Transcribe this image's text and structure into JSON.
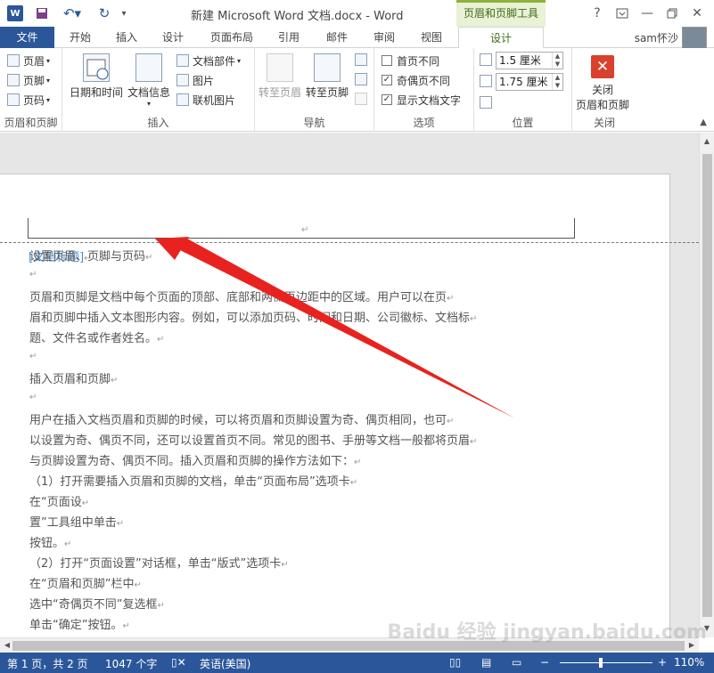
{
  "title_bar": {
    "doc_title": "新建 Microsoft Word 文档.docx - Word",
    "contextual_tab": "页眉和页脚工具",
    "help": "?"
  },
  "tabs": {
    "file": "文件",
    "items": [
      "开始",
      "插入",
      "设计",
      "页面布局",
      "引用",
      "邮件",
      "审阅",
      "视图"
    ],
    "active": "设计",
    "user": "sam怀沙"
  },
  "ribbon": {
    "group1": {
      "items": [
        "页眉",
        "页脚",
        "页码"
      ],
      "label": "页眉和页脚"
    },
    "group2": {
      "datetime": "日期和时间",
      "docinfo": "文档信息",
      "quickparts": "文档部件",
      "picture": "图片",
      "onlinepicture": "联机图片",
      "label": "插入"
    },
    "group3": {
      "goto_header": "转至页眉",
      "goto_footer": "转至页脚",
      "label": "导航"
    },
    "group4": {
      "options": [
        {
          "label": "首页不同",
          "checked": false
        },
        {
          "label": "奇偶页不同",
          "checked": true
        },
        {
          "label": "显示文档文字",
          "checked": true
        }
      ],
      "label": "选项"
    },
    "group5": {
      "header_pos": "1.5 厘米",
      "footer_pos": "1.75 厘米",
      "label": "位置"
    },
    "group6": {
      "close": "关闭",
      "close2": "页眉和页脚",
      "label": "关闭"
    }
  },
  "document": {
    "header_field": "[文档标题]",
    "lines": [
      "设置页眉、页脚与页码",
      "",
      "页眉和页脚是文档中每个页面的顶部、底部和两侧页边距中的区域。用户可以在页",
      "眉和页脚中插入文本图形内容。例如，可以添加页码、时间和日期、公司徽标、文档标",
      "题、文件名或作者姓名。",
      "",
      "插入页眉和页脚",
      "",
      "用户在插入文档页眉和页脚的时候，可以将页眉和页脚设置为奇、偶页相同，也可",
      "以设置为奇、偶页不同，还可以设置首页不同。常见的图书、手册等文档一般都将页眉",
      "与页脚设置为奇、偶页不同。插入页眉和页脚的操作方法如下：",
      "（1）打开需要插入页眉和页脚的文档，单击“页面布局”选项卡",
      "在“页面设",
      "置”工具组中单击",
      "按钮。",
      "（2）打开“页面设置”对话框，单击“版式”选项卡",
      "在“页眉和页脚”栏中",
      "选中“奇偶页不同”复选框",
      "单击“确定”按钮。"
    ]
  },
  "status": {
    "page": "第 1 页，共 2 页",
    "words": "1047 个字",
    "lang": "英语(美国)",
    "zoom": "110%"
  },
  "watermark": "Baidu 经验 jingyan.baidu.com"
}
